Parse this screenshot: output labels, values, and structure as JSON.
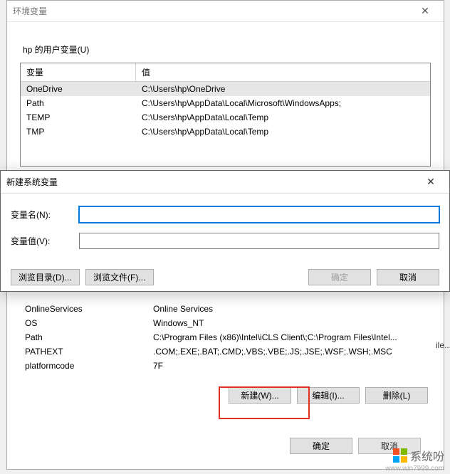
{
  "envDialog": {
    "title": "环境变量",
    "userSection": "hp 的用户变量(U)",
    "cols": {
      "name": "变量",
      "value": "值"
    },
    "userVars": [
      {
        "name": "OneDrive",
        "value": "C:\\Users\\hp\\OneDrive",
        "selected": true
      },
      {
        "name": "Path",
        "value": "C:\\Users\\hp\\AppData\\Local\\Microsoft\\WindowsApps;"
      },
      {
        "name": "TEMP",
        "value": "C:\\Users\\hp\\AppData\\Local\\Temp"
      },
      {
        "name": "TMP",
        "value": "C:\\Users\\hp\\AppData\\Local\\Temp"
      }
    ],
    "sysVarsVisible": [
      {
        "name": "OnlineServices",
        "value": "Online Services"
      },
      {
        "name": "OS",
        "value": "Windows_NT"
      },
      {
        "name": "Path",
        "value": "C:\\Program Files (x86)\\Intel\\iCLS Client\\;C:\\Program Files\\Intel..."
      },
      {
        "name": "PATHEXT",
        "value": ".COM;.EXE;.BAT;.CMD;.VBS;.VBE;.JS;.JSE;.WSF;.WSH;.MSC"
      },
      {
        "name": "platformcode",
        "value": "7F"
      }
    ],
    "sysButtons": {
      "new": "新建(W)...",
      "edit": "编辑(I)...",
      "delete": "删除(L)"
    },
    "bottom": {
      "ok": "确定",
      "cancel": "取消"
    }
  },
  "newVarDialog": {
    "title": "新建系统变量",
    "nameLabel": "变量名(N):",
    "valueLabel": "变量值(V):",
    "nameValue": "",
    "valueValue": "",
    "browseDir": "浏览目录(D)...",
    "browseFile": "浏览文件(F)...",
    "ok": "确定",
    "cancel": "取消"
  },
  "watermark": {
    "text": "系统吩",
    "sub": "www.win7999.com"
  },
  "edgeHints": {
    "ile": "ile..."
  }
}
